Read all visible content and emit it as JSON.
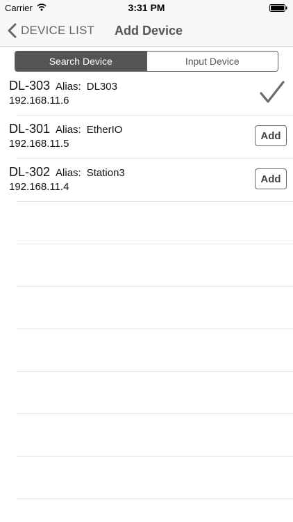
{
  "status_bar": {
    "carrier": "Carrier",
    "time": "3:31 PM"
  },
  "nav": {
    "back_label": "DEVICE LIST",
    "title": "Add Device"
  },
  "segments": {
    "search": "Search Device",
    "input": "Input Device",
    "selected": "Search Device"
  },
  "devices": [
    {
      "name": "DL-303",
      "alias_label": "Alias:",
      "alias": "DL303",
      "ip": "192.168.11.6",
      "status": "added"
    },
    {
      "name": "DL-301",
      "alias_label": "Alias:",
      "alias": "EtherIO",
      "ip": "192.168.11.5",
      "add_label": "Add"
    },
    {
      "name": "DL-302",
      "alias_label": "Alias:",
      "alias": "Station3",
      "ip": "192.168.11.4",
      "add_label": "Add"
    }
  ],
  "icons": {
    "wifi": "wifi-icon",
    "battery": "battery-icon",
    "back": "chevron-left-icon",
    "added": "checkmark-icon"
  }
}
